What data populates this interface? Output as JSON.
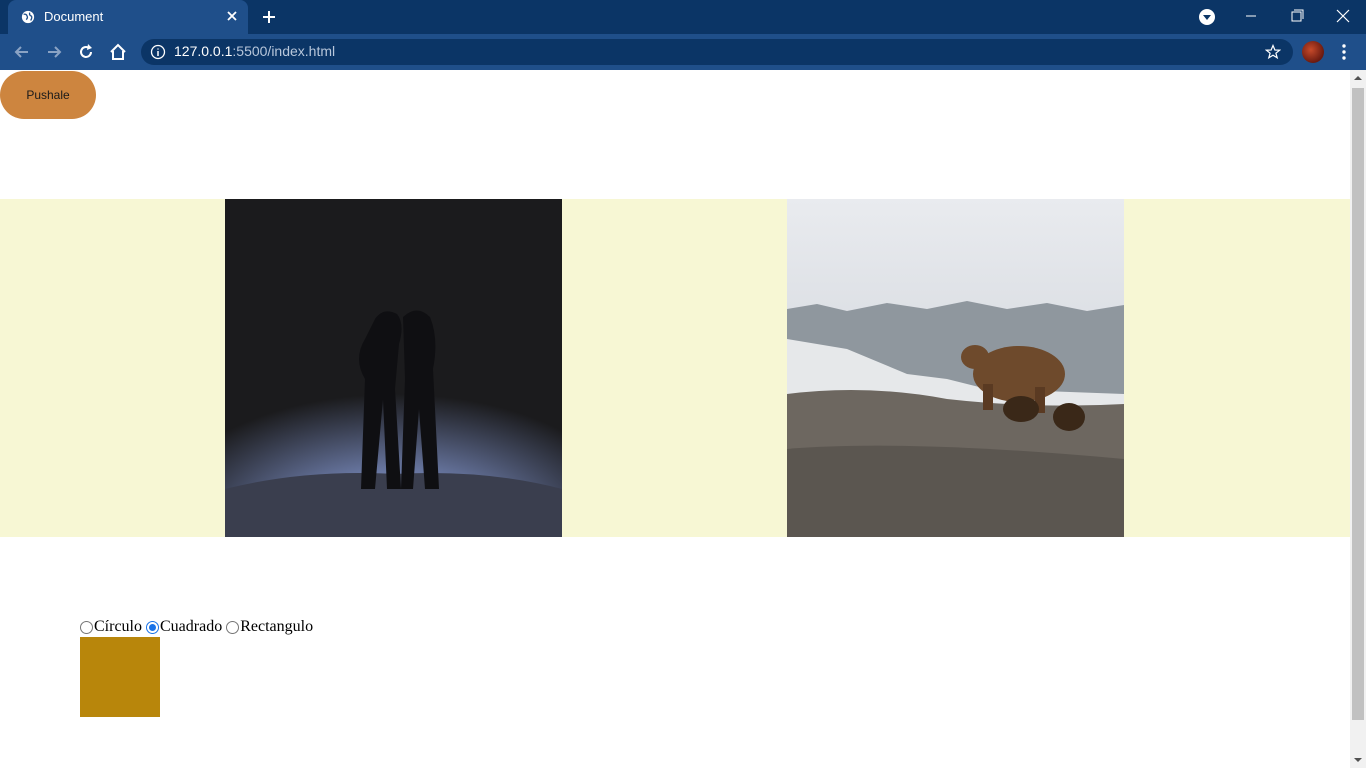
{
  "browser": {
    "tab_title": "Document",
    "url_host": "127.0.0.1",
    "url_rest": ":5500/index.html"
  },
  "page": {
    "button_label": "Pushale",
    "gallery_background": "#f7f7d4",
    "shape_options": [
      {
        "label": "Círculo",
        "checked": false
      },
      {
        "label": "Cuadrado",
        "checked": true
      },
      {
        "label": "Rectangulo",
        "checked": false
      }
    ],
    "selected_shape": "Cuadrado",
    "shape_color": "#b8860b",
    "button_color": "#cd853f"
  },
  "icons": [
    "globe-icon",
    "close-icon",
    "plus-icon",
    "tab-search-icon",
    "minimize-icon",
    "restore-icon",
    "back-icon",
    "forward-icon",
    "reload-icon",
    "home-icon",
    "info-icon",
    "star-icon",
    "kebab-menu-icon"
  ]
}
